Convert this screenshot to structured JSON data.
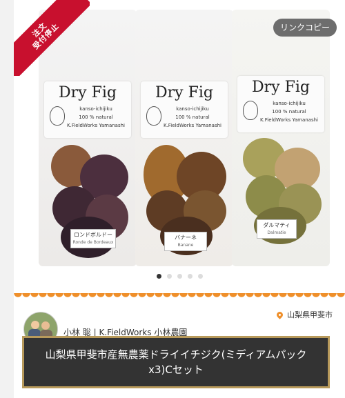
{
  "badge": {
    "line1": "注文",
    "line2": "受付停止"
  },
  "copy_button": {
    "label": "リンクコピー"
  },
  "bags": [
    {
      "brand": "Dry Fig",
      "sub1": "kanso-ichijiku",
      "sub2": "100 % natural",
      "sub3": "K.FieldWorks Yamanashi",
      "variety": "ロンドボルドー",
      "variety_en": "Ronde de Bordeaux"
    },
    {
      "brand": "Dry Fig",
      "sub1": "kanso-ichijiku",
      "sub2": "100 % natural",
      "sub3": "K.FieldWorks Yamanashi",
      "variety": "バナーネ",
      "variety_en": "Banane"
    },
    {
      "brand": "Dry Fig",
      "sub1": "kanso-ichijiku",
      "sub2": "100 % natural",
      "sub3": "K.FieldWorks Yamanashi",
      "variety": "ダルマティ",
      "variety_en": "Dalmatie"
    }
  ],
  "carousel": {
    "count": 5,
    "active": 0
  },
  "author": {
    "name": "小林 聡 | K.FieldWorks 小林農園"
  },
  "location": {
    "text": "山梨県甲斐市"
  },
  "product": {
    "title": "山梨県甲斐市産無農薬ドライイチジク(ミディアムパックx3)Cセット"
  },
  "colors": {
    "accent": "#ef8f2a",
    "ribbon": "#c8102e",
    "title_bg": "#333333",
    "title_border": "#b89a5b"
  }
}
